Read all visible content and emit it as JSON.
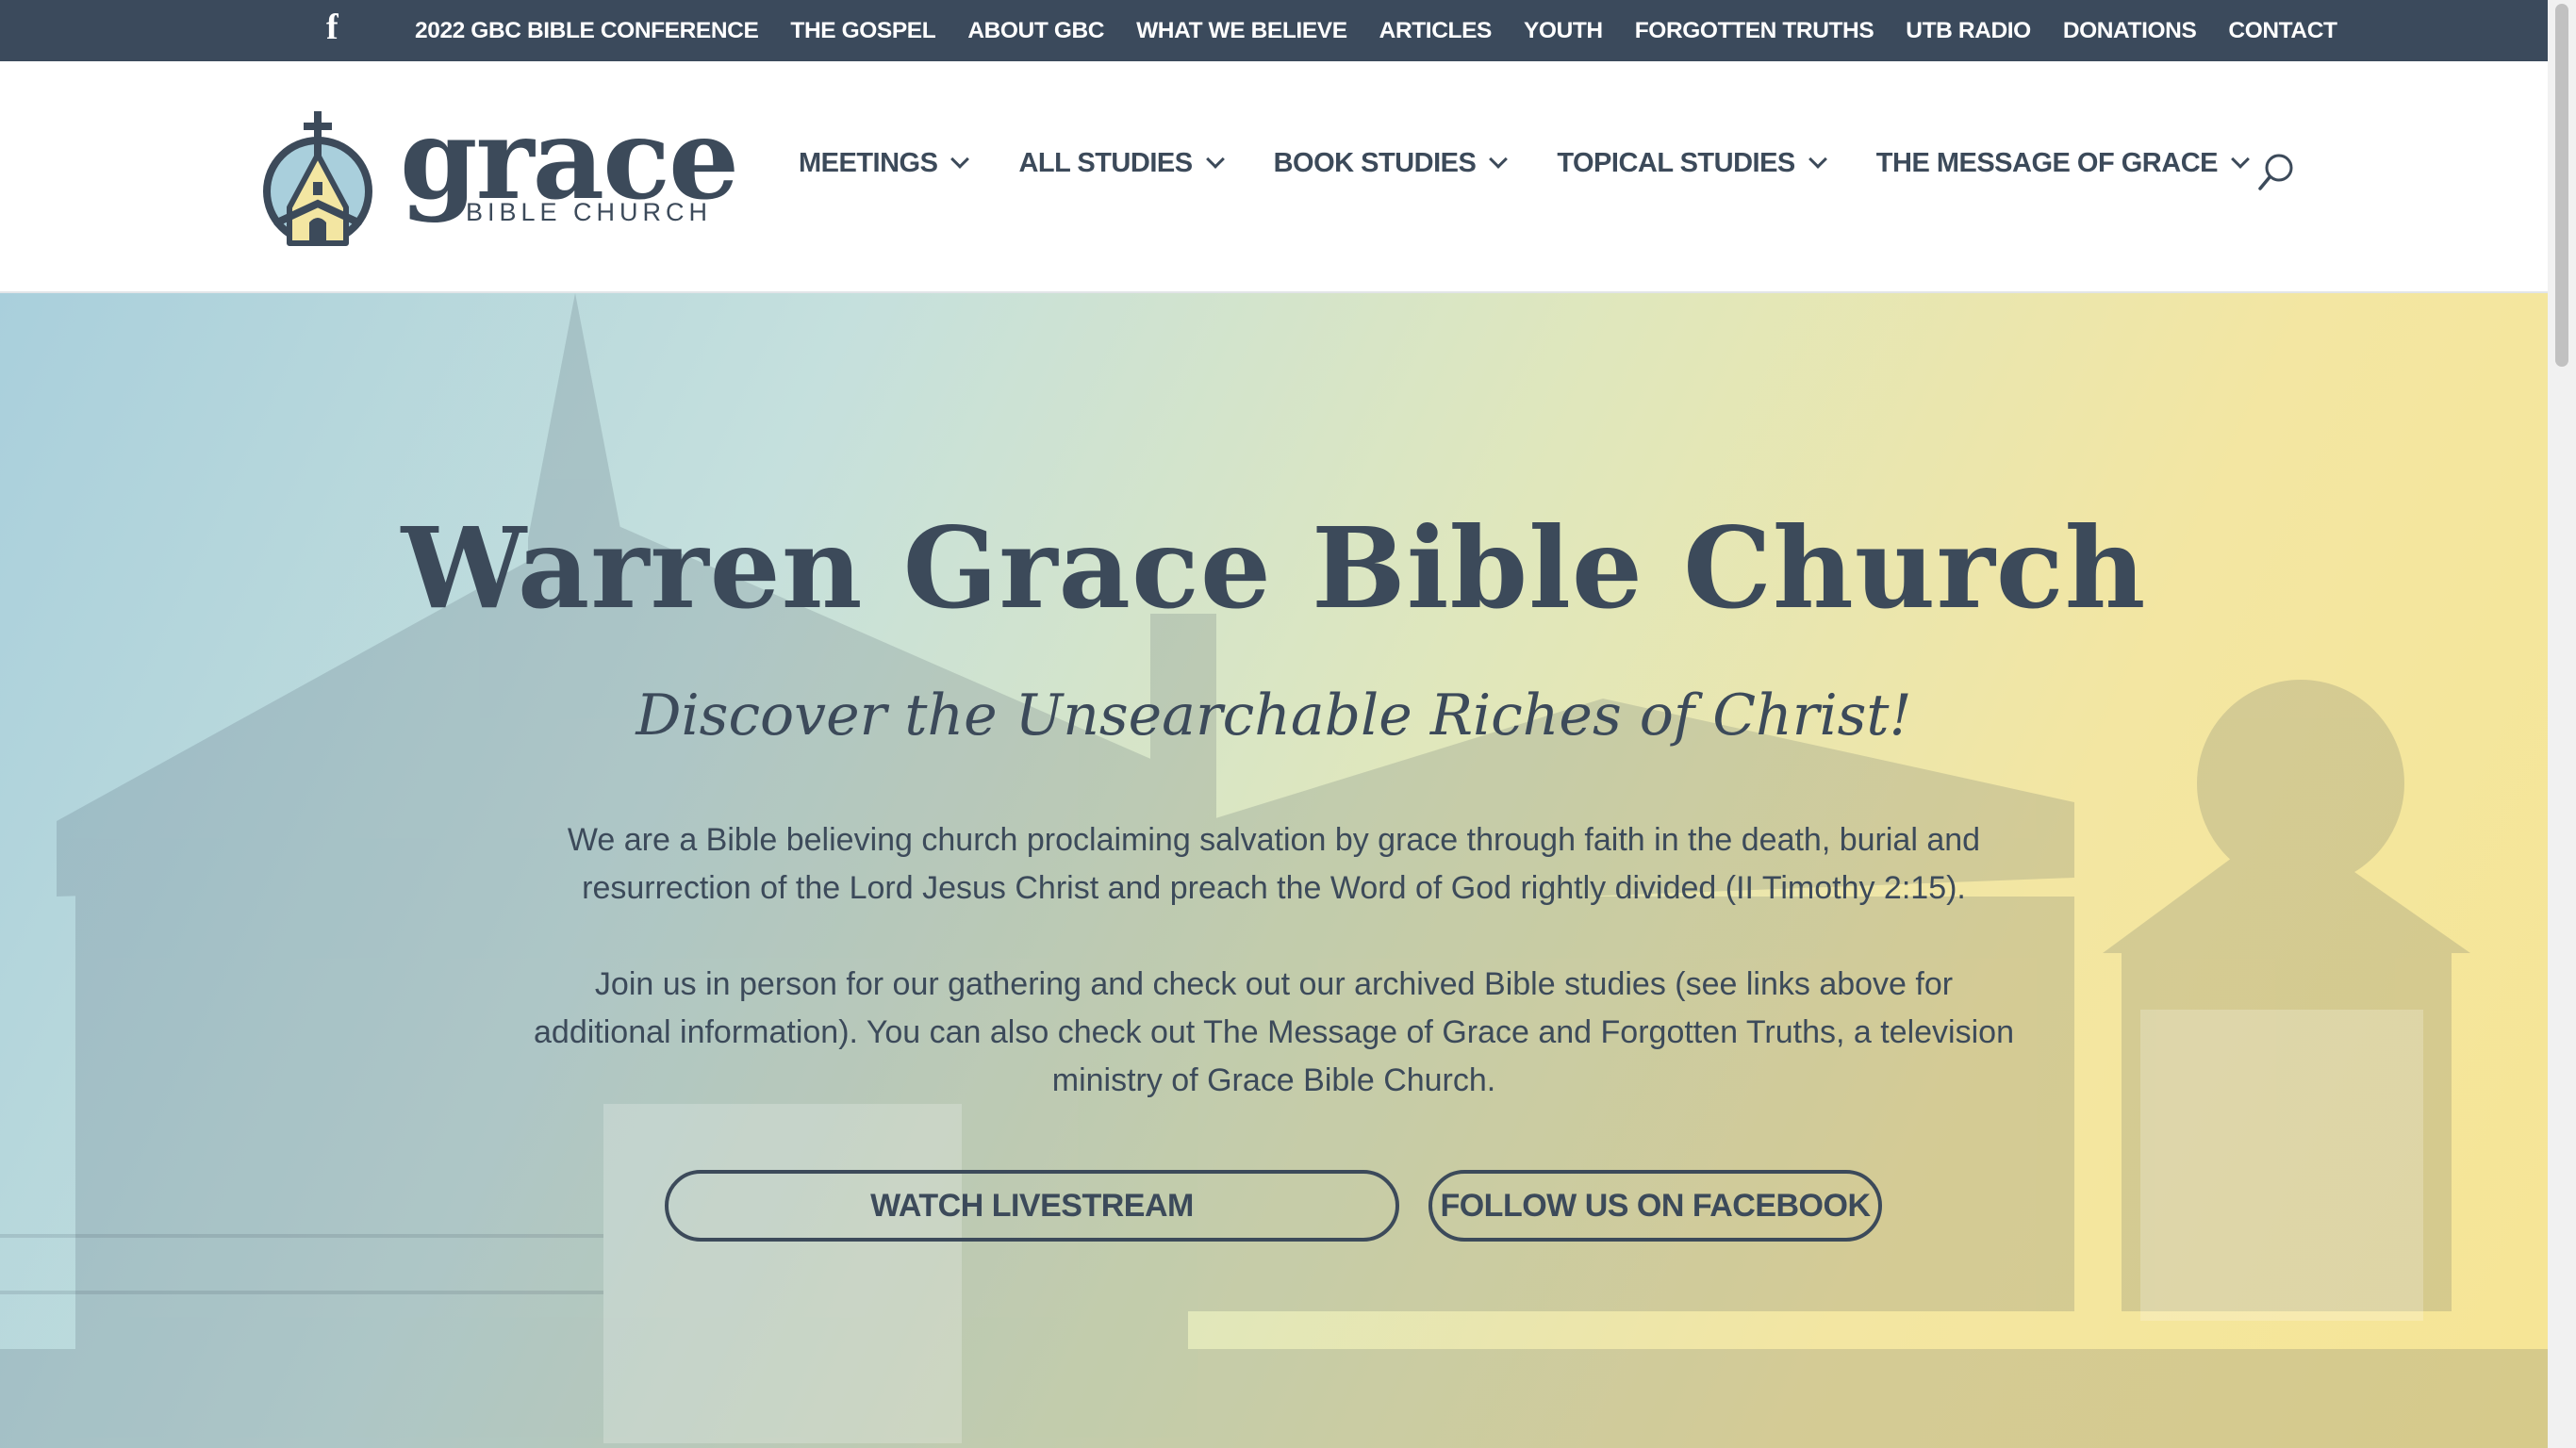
{
  "topbar": {
    "facebook_icon": "facebook-f-icon",
    "links": [
      "2022 GBC BIBLE CONFERENCE",
      "THE GOSPEL",
      "ABOUT GBC",
      "WHAT WE BELIEVE",
      "ARTICLES",
      "YOUTH",
      "FORGOTTEN TRUTHS",
      "UTB RADIO",
      "DONATIONS",
      "CONTACT"
    ]
  },
  "header": {
    "logo": {
      "word": "grace",
      "sub": "BIBLE CHURCH",
      "icon": "church-cross-icon"
    },
    "nav": [
      "MEETINGS",
      "ALL STUDIES",
      "BOOK STUDIES",
      "TOPICAL STUDIES",
      "THE MESSAGE OF GRACE"
    ],
    "search_icon": "search-icon"
  },
  "hero": {
    "title": "Warren Grace Bible Church",
    "subtitle": "Discover the Unsearchable Riches of Christ!",
    "paragraph1": "We are a Bible believing church proclaiming salvation by grace through faith in the death, burial and resurrection of the Lord Jesus Christ and preach the Word of God rightly divided (II Timothy 2:15).",
    "paragraph2": "Join us in person for our gathering and check out our archived Bible studies (see links above for additional information).  You can also check out The Message of Grace and Forgotten Truths, a television ministry of Grace Bible Church.",
    "buttons": {
      "livestream": "WATCH LIVESTREAM",
      "facebook": "FOLLOW US ON FACEBOOK"
    }
  },
  "colors": {
    "topbar": "#3b4a5c",
    "text": "#3c4a5a",
    "hero_left": "#a9cfdc",
    "hero_right": "#f6e595"
  }
}
